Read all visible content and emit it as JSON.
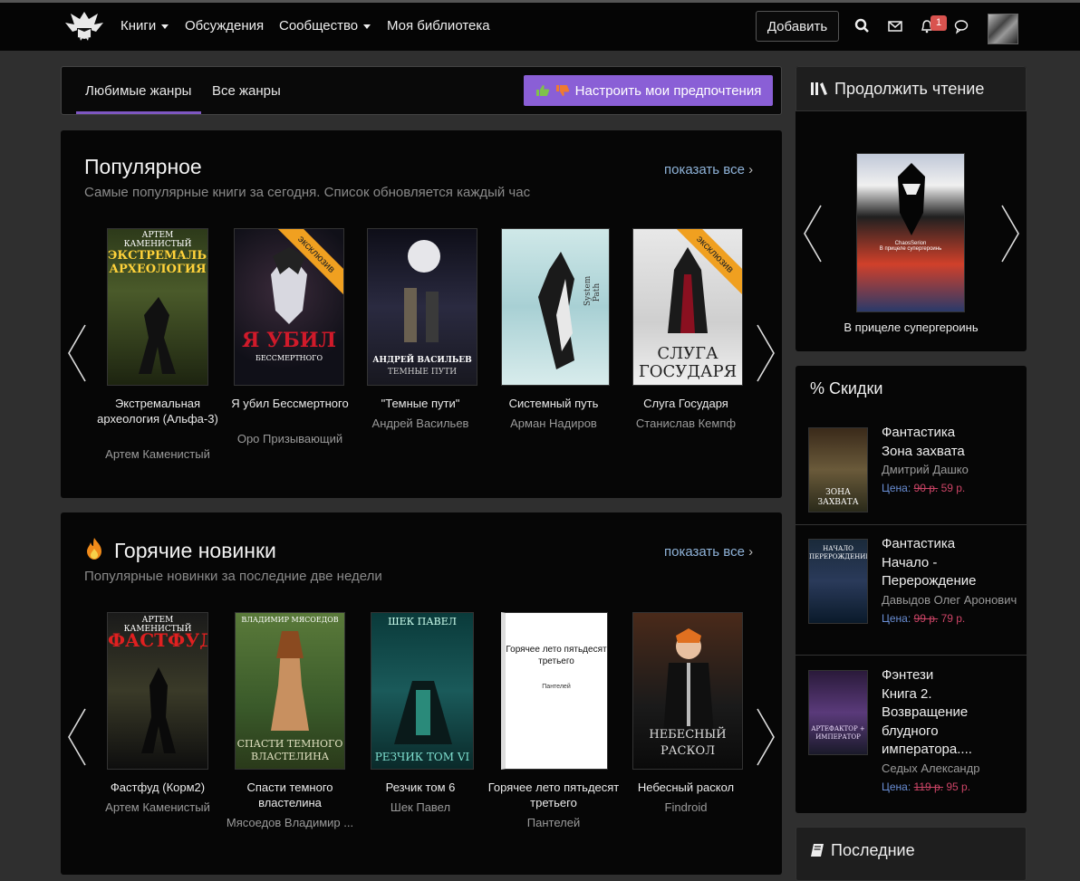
{
  "nav": {
    "items": [
      {
        "label": "Книги",
        "dropdown": true
      },
      {
        "label": "Обсуждения",
        "dropdown": false
      },
      {
        "label": "Сообщество",
        "dropdown": true
      },
      {
        "label": "Моя библиотека",
        "dropdown": false
      }
    ],
    "add_label": "Добавить",
    "notification_count": "1"
  },
  "tabs": {
    "items": [
      "Любимые жанры",
      "Все жанры"
    ],
    "active": "Любимые жанры",
    "pref_label": "Настроить мои предпочтения"
  },
  "popular": {
    "title": "Популярное",
    "subtitle": "Самые популярные книги за сегодня. Список обновляется каждый час",
    "show_all": "показать все",
    "books": [
      {
        "title": "Экстремальная археология (Альфа-3)",
        "author": "Артем Каменистый",
        "cover_top": "АРТЕМ КАМЕНИСТЫЙ",
        "cover_main": "ЭКСТРЕМАЛЬНАЯ АРХЕОЛОГИЯ",
        "ribbon": ""
      },
      {
        "title": "Я убил Бессмертного",
        "author": "Оро Призывающий",
        "cover_top": "",
        "cover_main": "Я УБИЛ",
        "cover_sub": "БЕССМЕРТНОГО",
        "ribbon": "эксклюзив"
      },
      {
        "title": "\"Темные пути\"",
        "author": "Андрей Васильев",
        "cover_top": "",
        "cover_main": "АНДРЕЙ ВАСИЛЬЕВ",
        "cover_sub": "ТЕМНЫЕ ПУТИ",
        "ribbon": ""
      },
      {
        "title": "Системный путь",
        "author": "Арман Надиров",
        "cover_top": "",
        "cover_main": "System Path",
        "ribbon": ""
      },
      {
        "title": "Слуга Государя",
        "author": "Станислав Кемпф",
        "cover_top": "",
        "cover_main": "СЛУГА ГОСУДАРЯ",
        "ribbon": "эксклюзив"
      }
    ]
  },
  "hot": {
    "title": "Горячие новинки",
    "subtitle": "Популярные новинки за последние две недели",
    "show_all": "показать все",
    "books": [
      {
        "title": "Фастфуд (Корм2)",
        "author": "Артем Каменистый",
        "cover_top": "АРТЕМ КАМЕНИСТЫЙ",
        "cover_main": "ФАСТФУД"
      },
      {
        "title": "Спасти темного властелина",
        "author": "Мясоедов Владимир ...",
        "cover_top": "ВЛАДИМИР МЯСОЕДОВ",
        "cover_main": "СПАСТИ ТЕМНОГО ВЛАСТЕЛИНА"
      },
      {
        "title": "Резчик том 6",
        "author": "Шек Павел",
        "cover_top": "ШЕК ПАВЕЛ",
        "cover_main": "РЕЗЧИК ТОМ VI"
      },
      {
        "title": "Горячее лето пятьдесят третьего",
        "author": "Пантелей",
        "cover_top": "Горячее лето пятьдесят третьего",
        "cover_main": "Пантелей"
      },
      {
        "title": "Небесный раскол",
        "author": "Findroid",
        "cover_top": "",
        "cover_main": "НЕБЕСНЫЙ РАСКОЛ"
      }
    ]
  },
  "continue": {
    "title": "Продолжить чтение",
    "book_title": "В прицеле супергероинь",
    "cover_text": "ChaosSerion\nВ прицеле супергероинь"
  },
  "deals": {
    "title": "% Скидки",
    "items": [
      {
        "genre": "Фантастика",
        "title": "Зона захвата",
        "author": "Дмитрий Дашко",
        "price_label": "Цена:",
        "old_price": "90 р.",
        "new_price": "59 р.",
        "cover_text": "ЗОНА ЗАХВАТА"
      },
      {
        "genre": "Фантастика",
        "title": "Начало - Перерождение",
        "author": "Давыдов Олег Аронович",
        "price_label": "Цена:",
        "old_price": "99 р.",
        "new_price": "79 р.",
        "cover_text": "НАЧАЛО ПЕРЕРОЖДЕНИЕ"
      },
      {
        "genre": "Фэнтези",
        "title": "Книга 2. Возвращение блудного императора....",
        "author": "Седых Александр",
        "price_label": "Цена:",
        "old_price": "119 р.",
        "new_price": "95 р.",
        "cover_text": "АРТЕФАКТОР + ИМПЕРАТОР"
      }
    ]
  },
  "latest": {
    "title": "Последние"
  },
  "colors": {
    "accent": "#8a5fd6",
    "ribbon": "#f0a020",
    "link": "#8fb3d9",
    "badge": "#d9534f"
  }
}
